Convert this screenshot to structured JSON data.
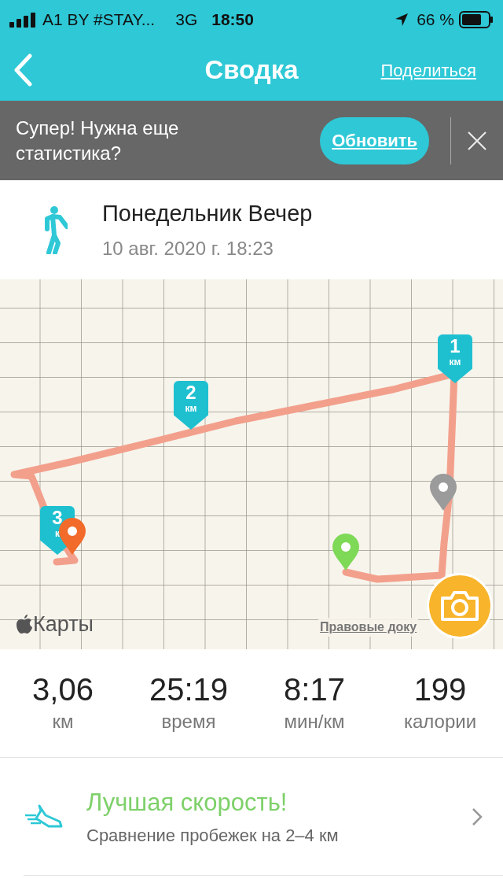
{
  "status_bar": {
    "carrier": "A1 BY #STAY...",
    "network": "3G",
    "time": "18:50",
    "battery": "66 %"
  },
  "nav": {
    "title": "Сводка",
    "action": "Поделиться"
  },
  "banner": {
    "text": "Супер! Нужна еще статистика?",
    "button": "Обновить"
  },
  "activity": {
    "title": "Понедельник Вечер",
    "date": "10 авг. 2020 г. 18:23"
  },
  "map": {
    "logo": "Карты",
    "legal": "Правовые доку",
    "km_markers": [
      {
        "number": "1",
        "unit": "км"
      },
      {
        "number": "2",
        "unit": "км"
      },
      {
        "number": "3",
        "unit": "к"
      }
    ],
    "pins": [
      {
        "kind": "start",
        "color": "#7ed957"
      },
      {
        "kind": "pause",
        "color": "#9b9b9b"
      },
      {
        "kind": "finish",
        "color": "#f26b2a"
      }
    ]
  },
  "stats": [
    {
      "value": "3,06",
      "label": "км"
    },
    {
      "value": "25:19",
      "label": "время"
    },
    {
      "value": "8:17",
      "label": "мин/км"
    },
    {
      "value": "199",
      "label": "калории"
    }
  ],
  "achievement": {
    "title": "Лучшая скорость!",
    "subtitle": "Сравнение пробежек на 2–4 км"
  }
}
